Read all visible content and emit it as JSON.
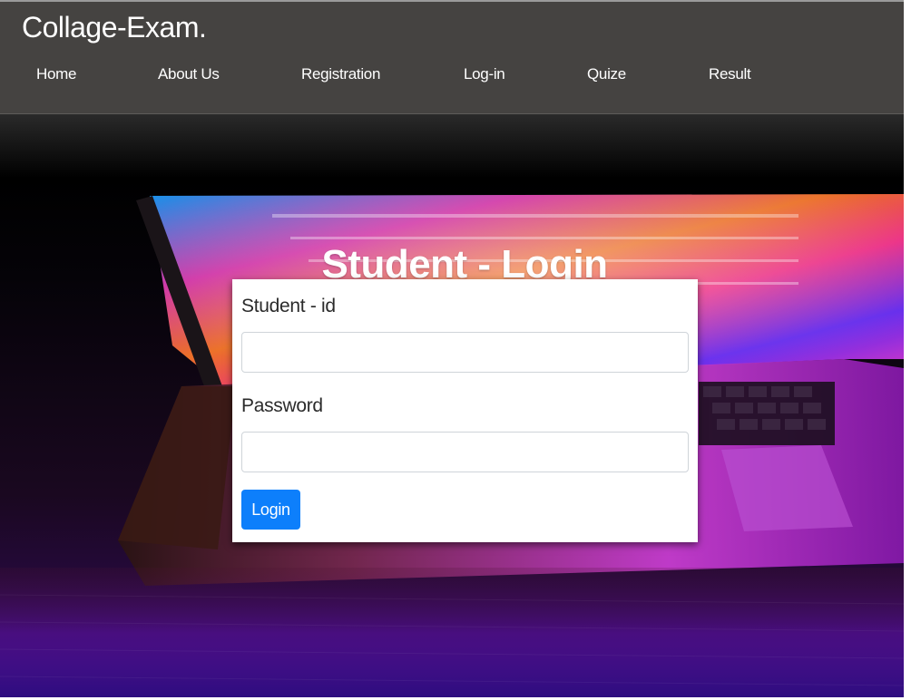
{
  "brand": {
    "title": "Collage-Exam."
  },
  "nav": {
    "items": [
      {
        "label": "Home"
      },
      {
        "label": "About Us"
      },
      {
        "label": "Registration"
      },
      {
        "label": "Log-in"
      },
      {
        "label": "Quize"
      },
      {
        "label": "Result"
      }
    ]
  },
  "page": {
    "heading": "Student - Login"
  },
  "form": {
    "student_id_label": "Student - id",
    "student_id_value": "",
    "password_label": "Password",
    "password_value": "",
    "submit_label": "Login"
  },
  "colors": {
    "navbar_bg": "#454341",
    "button_primary": "#0d7ffb",
    "card_bg": "#ffffff",
    "hero_accent_magenta": "#ff2fd6",
    "hero_accent_blue": "#2a8cff"
  },
  "hero": {
    "image": "laptop-with-colorful-screen"
  }
}
